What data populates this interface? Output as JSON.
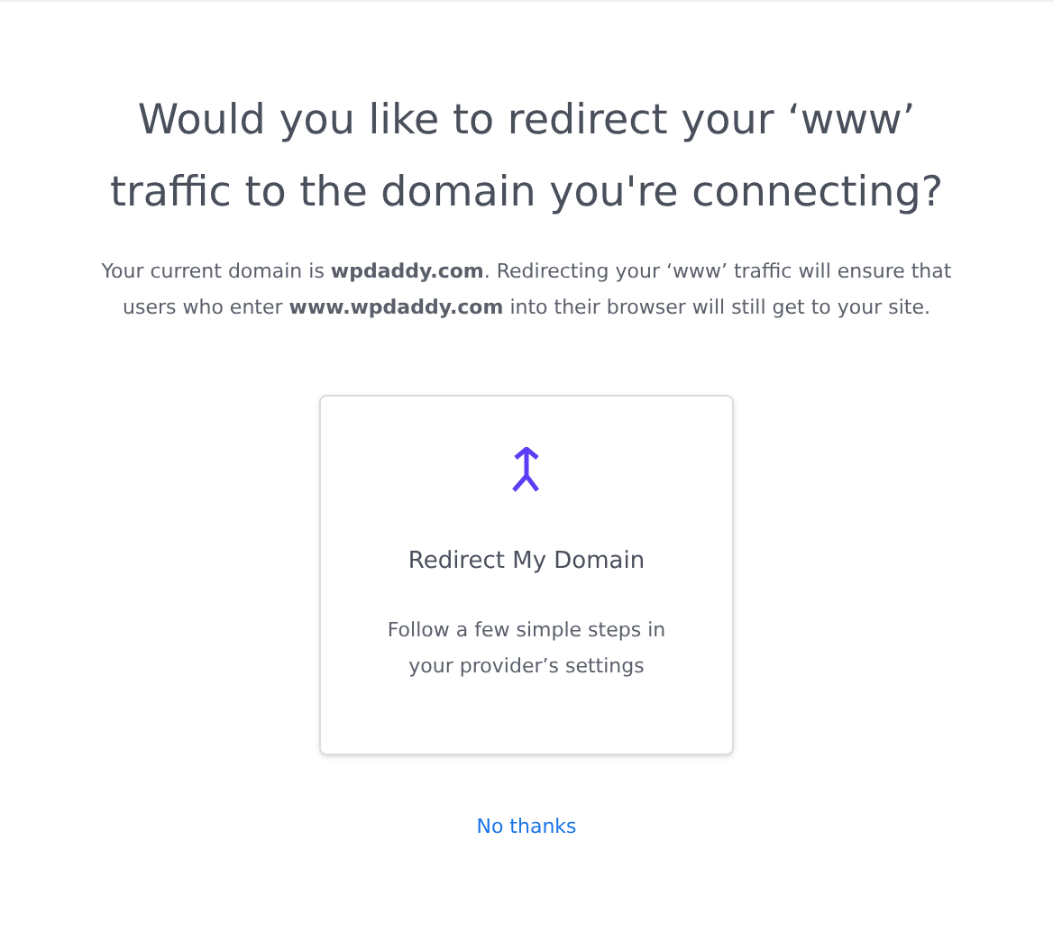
{
  "title": "Would you like to redirect your ‘www’ traffic to the domain you're connecting?",
  "description": "Your current domain is **wpdaddy.com**. Redirecting your ‘www’ traffic will ensure that users who enter **www.wpdaddy.com** into their browser will still get to your site.",
  "option": {
    "title": "Redirect My Domain",
    "description": "Follow a few simple steps in your provider’s settings"
  },
  "skip_link": "No thanks"
}
